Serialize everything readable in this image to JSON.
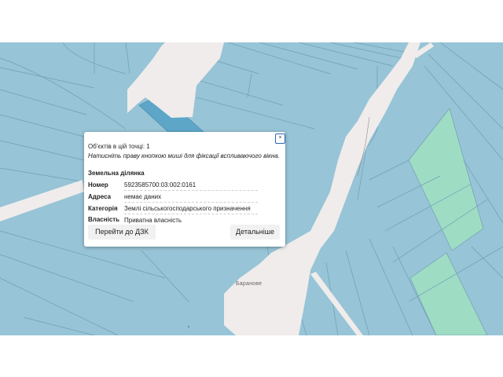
{
  "map": {
    "place_label": "Баранове",
    "colors": {
      "parcel_private": "#97c4d6",
      "parcel_selected": "#5ea6c8",
      "parcel_green": "#9fdcc4",
      "road": "#efeceb",
      "boundary": "#6f9fb3"
    }
  },
  "popup": {
    "close_label": "×",
    "count_text": "Об'єктів в цій точці: 1",
    "hint_text": "Натисніть праву кнопкою миші для фіксації вспливаючого вікна.",
    "section_title": "Земельна ділянка",
    "fields": [
      {
        "key": "Номер",
        "value": "5923585700:03:002:0161"
      },
      {
        "key": "Адреса",
        "value": "немає даних"
      },
      {
        "key": "Категорія",
        "value": "Землі сільськогосподарського призначення"
      },
      {
        "key": "Власність",
        "value": "Приватна власність"
      }
    ],
    "dzk_button": "Перейти до ДЗК",
    "details_button": "Детальніше"
  }
}
